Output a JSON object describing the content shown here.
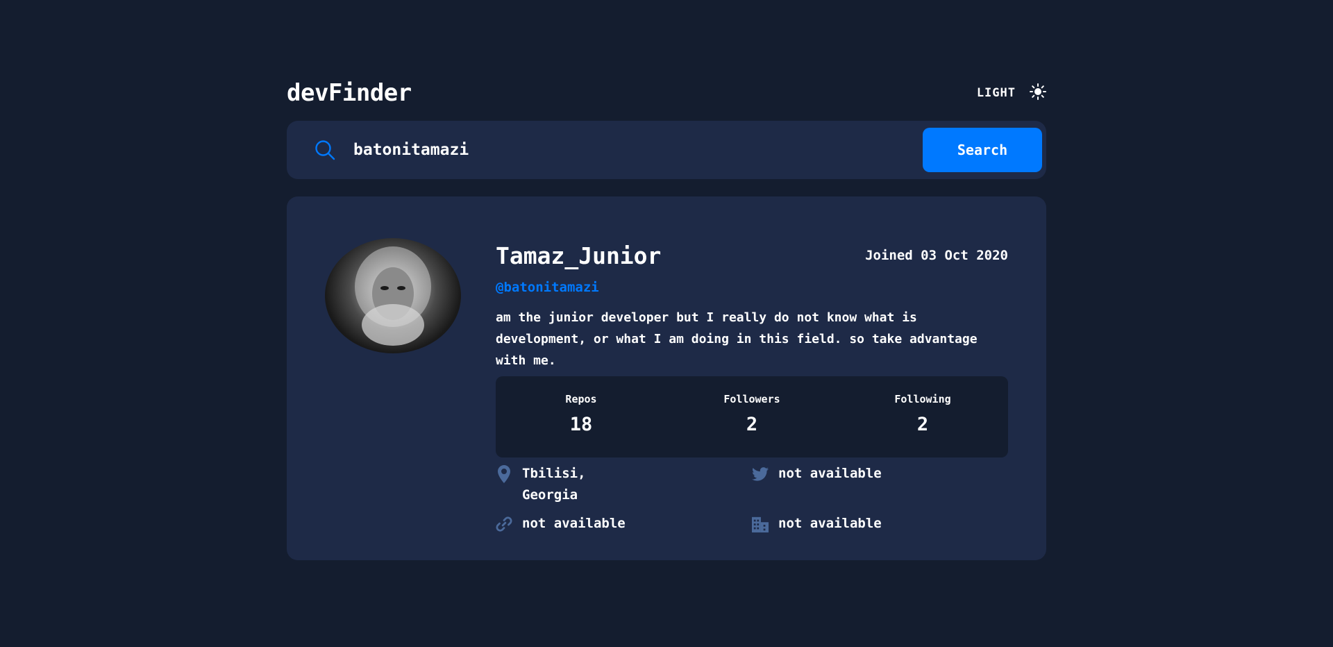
{
  "app": {
    "title": "devFinder",
    "theme_label": "LIGHT"
  },
  "search": {
    "value": "batonitamazi",
    "button_label": "Search"
  },
  "profile": {
    "name": "Tamaz_Junior",
    "joined": "Joined 03 Oct 2020",
    "login": "@batonitamazi",
    "bio": "am the junior developer but I really do not know what is development, or what I am doing in this field. so take advantage with me."
  },
  "stats": [
    {
      "label": "Repos",
      "value": "18"
    },
    {
      "label": "Followers",
      "value": "2"
    },
    {
      "label": "Following",
      "value": "2"
    }
  ],
  "links": {
    "location": "Tbilisi, Georgia",
    "twitter": "not available",
    "blog": "not available",
    "company": "not available"
  },
  "colors": {
    "background": "#141d2f",
    "card": "#1e2a47",
    "accent": "#0079ff",
    "icon": "#4b6a9b",
    "text": "#ffffff"
  }
}
